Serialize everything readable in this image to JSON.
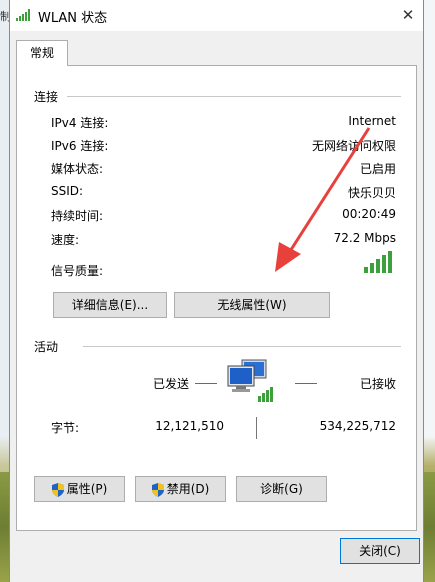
{
  "window": {
    "title": "WLAN 状态",
    "close_glyph": "✕"
  },
  "tab": {
    "label": "常规"
  },
  "connection": {
    "heading": "连接",
    "rows": [
      {
        "label": "IPv4 连接:",
        "value": "Internet"
      },
      {
        "label": "IPv6 连接:",
        "value": "无网络访问权限"
      },
      {
        "label": "媒体状态:",
        "value": "已启用"
      },
      {
        "label": "SSID:",
        "value": "快乐贝贝"
      },
      {
        "label": "持续时间:",
        "value": "00:20:49"
      },
      {
        "label": "速度:",
        "value": "72.2 Mbps"
      }
    ],
    "signal_label": "信号质量:",
    "signal_bars": 5,
    "buttons": {
      "details": "详细信息(E)...",
      "wireless_props": "无线属性(W)"
    }
  },
  "activity": {
    "heading": "活动",
    "sent_label": "已发送",
    "received_label": "已接收",
    "bytes_label": "字节:",
    "bytes_sent": "12,121,510",
    "bytes_received": "534,225,712"
  },
  "bottom_buttons": {
    "properties": "属性(P)",
    "disable": "禁用(D)",
    "diagnose": "诊断(G)"
  },
  "footer": {
    "close": "关闭(C)"
  },
  "background": {
    "left_text": "制"
  },
  "colors": {
    "signal": "#3ca03c",
    "arrow": "#e8413c",
    "focus_border": "#0078d7"
  }
}
